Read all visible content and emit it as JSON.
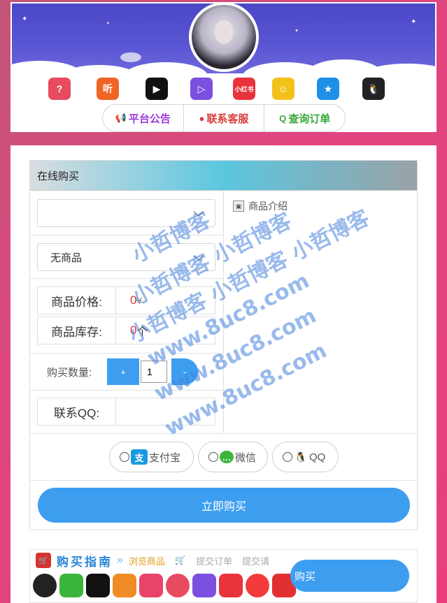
{
  "header": {
    "nav": [
      {
        "label": "平台公告",
        "icon": "megaphone-icon",
        "color": "#9b3bd6"
      },
      {
        "label": "联系客服",
        "icon": "user-circle-icon",
        "color": "#d83a3a"
      },
      {
        "label": "查询订单",
        "icon": "search-icon",
        "color": "#3aa83a"
      }
    ],
    "apps": [
      {
        "name": "kuaishou-music-icon",
        "color": "#e84a5f",
        "glyph": "?"
      },
      {
        "name": "ting-icon",
        "color": "#f06425",
        "glyph": "听"
      },
      {
        "name": "video-play-icon",
        "color": "#111111",
        "glyph": "▶"
      },
      {
        "name": "media-play-icon",
        "color": "#7b4fe0",
        "glyph": "▷"
      },
      {
        "name": "xiaohongshu-icon",
        "color": "#e8323c",
        "glyph": "小红书"
      },
      {
        "name": "cartoon-face-icon",
        "color": "#f2c21b",
        "glyph": "☺"
      },
      {
        "name": "qzone-star-icon",
        "color": "#1e90e8",
        "glyph": "★"
      },
      {
        "name": "qq-penguin-icon",
        "color": "#222222",
        "glyph": "🐧"
      }
    ]
  },
  "purchase": {
    "title": "在线购买",
    "category_select": "",
    "product_select": "无商品",
    "price_label": "商品价格:",
    "price_value": "0",
    "price_unit": "¥",
    "stock_label": "商品库存:",
    "stock_value": "0",
    "stock_unit": "个",
    "qty_label": "购买数量:",
    "qty_plus": "+",
    "qty_value": "1",
    "qty_minus": "-",
    "qq_label": "联系QQ:",
    "qq_value": "",
    "description": "商品介绍",
    "payments": [
      {
        "label": "支付宝",
        "logo": "支",
        "color": "#1a9ae0"
      },
      {
        "label": "微信",
        "logo": "…",
        "color": "#3bb53b"
      },
      {
        "label": "QQ",
        "logo": "🐧",
        "color": "#333333"
      }
    ],
    "buy_button": "立即购买"
  },
  "guide": {
    "title": "购买指南",
    "step1": "浏览商品",
    "step2": "提交订单",
    "step3": "提交请",
    "step1_color": "#e0a020"
  },
  "floating_button": "购买",
  "watermark": {
    "line1": "小哲博客",
    "line2": "小哲博客 小哲博客",
    "line3": "小哲博客 小哲博客 小哲博客",
    "line4": "www.8uc8.com",
    "line5": "www.8uc8.com",
    "line6": "www.8uc8.com"
  }
}
